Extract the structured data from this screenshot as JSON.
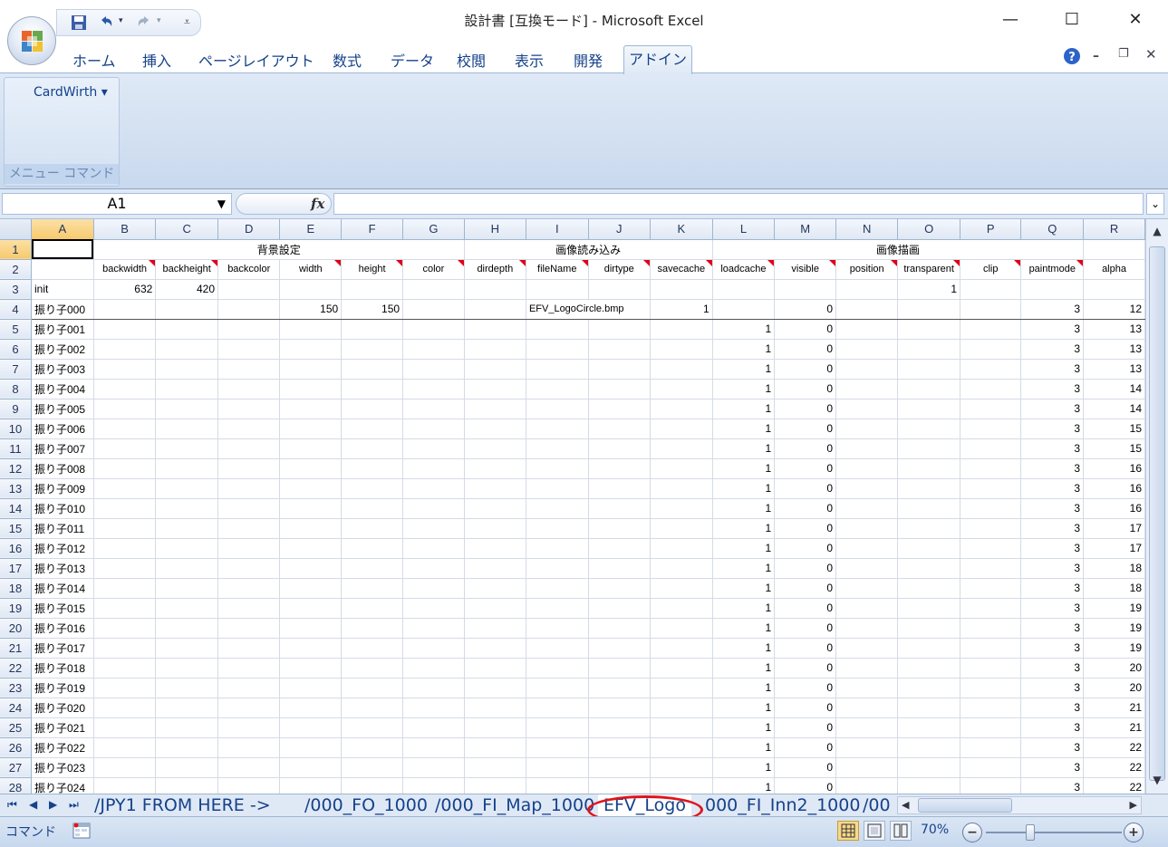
{
  "window": {
    "title": "設計書  [互換モード] - Microsoft Excel",
    "minimize": "—",
    "maximize": "☐",
    "close": "✕"
  },
  "ribbon": {
    "tabs": [
      "ホーム",
      "挿入",
      "ページレイアウト",
      "数式",
      "データ",
      "校閲",
      "表示",
      "開発"
    ],
    "active_tab": "アドイン",
    "menu_item": "CardWirth ▾",
    "group_label": "メニュー コマンド"
  },
  "formula_bar": {
    "name_box": "A1",
    "fx": "fx",
    "value": ""
  },
  "sheet": {
    "columns": [
      "A",
      "B",
      "C",
      "D",
      "E",
      "F",
      "G",
      "H",
      "I",
      "J",
      "K",
      "L",
      "M",
      "N",
      "O",
      "P",
      "Q",
      "R"
    ],
    "section_headers": {
      "bg": "背景設定",
      "load": "画像読み込み",
      "draw": "画像描画"
    },
    "fields": [
      "backwidth",
      "backheight",
      "backcolor",
      "width",
      "height",
      "color",
      "dirdepth",
      "fileName",
      "dirtype",
      "savecache",
      "loadcache",
      "visible",
      "position",
      "transparent",
      "clip",
      "paintmode",
      "alpha"
    ],
    "row3": {
      "label": "init",
      "B": "632",
      "C": "420",
      "O": "1"
    },
    "row4": {
      "label": "振り子000",
      "E": "150",
      "F": "150",
      "I": "EFV_LogoCircle.bmp",
      "K": "1",
      "M": "0",
      "Q": "3",
      "R": "12"
    },
    "rows": [
      {
        "num": "5",
        "label": "振り子001",
        "L": "1",
        "M": "0",
        "Q": "3",
        "R": "13"
      },
      {
        "num": "6",
        "label": "振り子002",
        "L": "1",
        "M": "0",
        "Q": "3",
        "R": "13"
      },
      {
        "num": "7",
        "label": "振り子003",
        "L": "1",
        "M": "0",
        "Q": "3",
        "R": "13"
      },
      {
        "num": "8",
        "label": "振り子004",
        "L": "1",
        "M": "0",
        "Q": "3",
        "R": "14"
      },
      {
        "num": "9",
        "label": "振り子005",
        "L": "1",
        "M": "0",
        "Q": "3",
        "R": "14"
      },
      {
        "num": "10",
        "label": "振り子006",
        "L": "1",
        "M": "0",
        "Q": "3",
        "R": "15"
      },
      {
        "num": "11",
        "label": "振り子007",
        "L": "1",
        "M": "0",
        "Q": "3",
        "R": "15"
      },
      {
        "num": "12",
        "label": "振り子008",
        "L": "1",
        "M": "0",
        "Q": "3",
        "R": "16"
      },
      {
        "num": "13",
        "label": "振り子009",
        "L": "1",
        "M": "0",
        "Q": "3",
        "R": "16"
      },
      {
        "num": "14",
        "label": "振り子010",
        "L": "1",
        "M": "0",
        "Q": "3",
        "R": "16"
      },
      {
        "num": "15",
        "label": "振り子011",
        "L": "1",
        "M": "0",
        "Q": "3",
        "R": "17"
      },
      {
        "num": "16",
        "label": "振り子012",
        "L": "1",
        "M": "0",
        "Q": "3",
        "R": "17"
      },
      {
        "num": "17",
        "label": "振り子013",
        "L": "1",
        "M": "0",
        "Q": "3",
        "R": "18"
      },
      {
        "num": "18",
        "label": "振り子014",
        "L": "1",
        "M": "0",
        "Q": "3",
        "R": "18"
      },
      {
        "num": "19",
        "label": "振り子015",
        "L": "1",
        "M": "0",
        "Q": "3",
        "R": "19"
      },
      {
        "num": "20",
        "label": "振り子016",
        "L": "1",
        "M": "0",
        "Q": "3",
        "R": "19"
      },
      {
        "num": "21",
        "label": "振り子017",
        "L": "1",
        "M": "0",
        "Q": "3",
        "R": "19"
      },
      {
        "num": "22",
        "label": "振り子018",
        "L": "1",
        "M": "0",
        "Q": "3",
        "R": "20"
      },
      {
        "num": "23",
        "label": "振り子019",
        "L": "1",
        "M": "0",
        "Q": "3",
        "R": "20"
      },
      {
        "num": "24",
        "label": "振り子020",
        "L": "1",
        "M": "0",
        "Q": "3",
        "R": "21"
      },
      {
        "num": "25",
        "label": "振り子021",
        "L": "1",
        "M": "0",
        "Q": "3",
        "R": "21"
      },
      {
        "num": "26",
        "label": "振り子022",
        "L": "1",
        "M": "0",
        "Q": "3",
        "R": "22"
      },
      {
        "num": "27",
        "label": "振り子023",
        "L": "1",
        "M": "0",
        "Q": "3",
        "R": "22"
      },
      {
        "num": "28",
        "label": "振り子024",
        "L": "1",
        "M": "0",
        "Q": "3",
        "R": "22"
      }
    ]
  },
  "sheet_tabs": [
    "JPY1 FROM HERE ->",
    "000_FO_1000",
    "000_FI_Map_1000",
    "EFV_Logo",
    "000_FI_Inn2_1000",
    "00"
  ],
  "active_sheet": "EFV_Logo",
  "status": {
    "mode": "コマンド",
    "zoom": "70%"
  },
  "colors": {
    "annotation_circle": "#e1141b",
    "comment_marker": "#e0001a",
    "ribbon_text": "#15428b"
  }
}
